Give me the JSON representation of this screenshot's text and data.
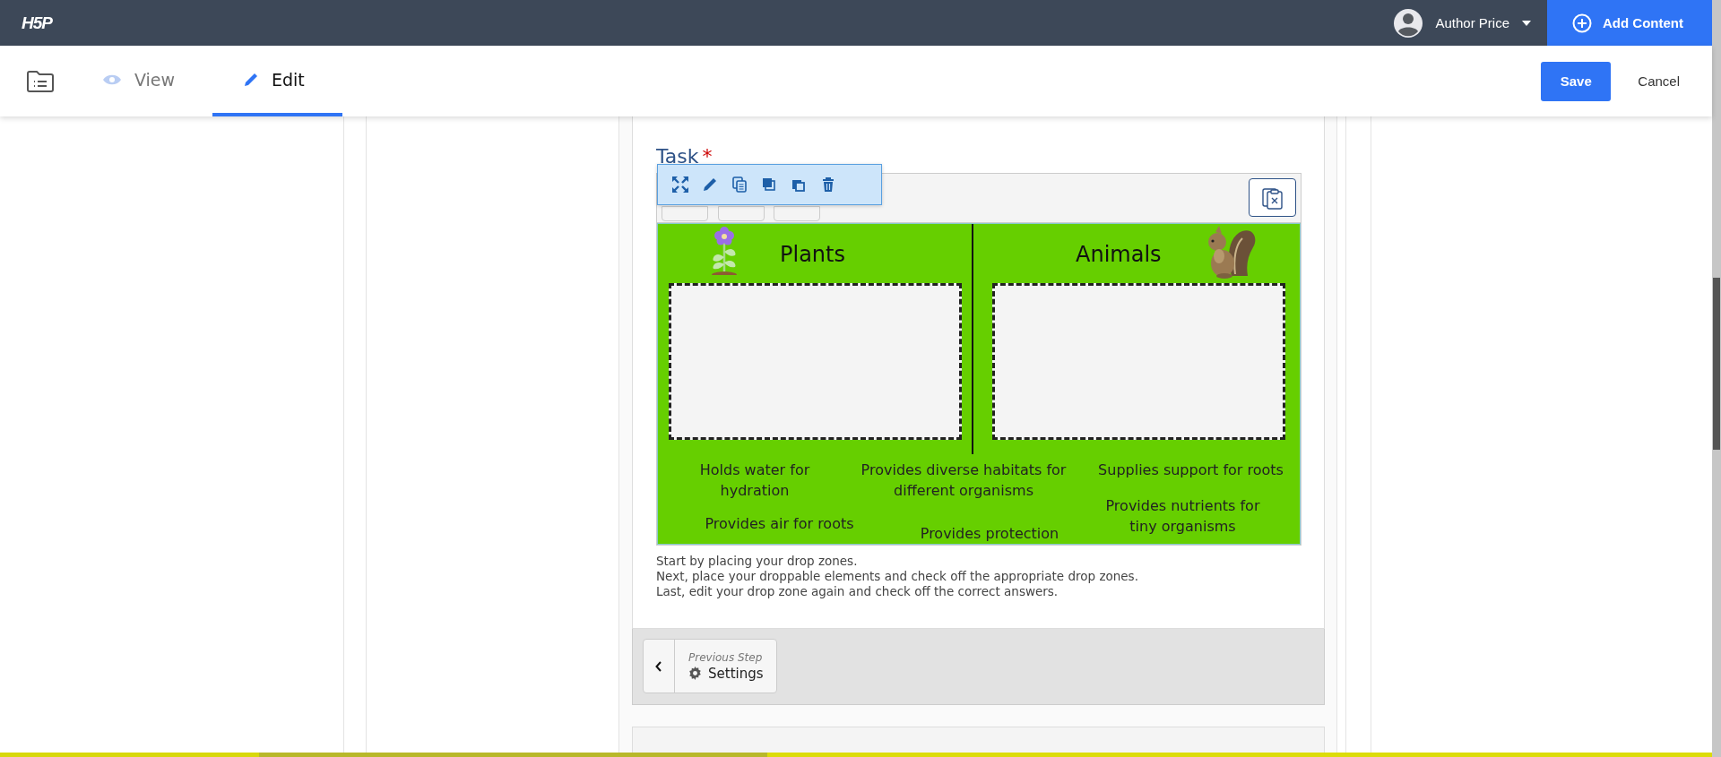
{
  "header": {
    "logo": "H5P",
    "user": "Author Price",
    "add_content": "Add Content"
  },
  "tabs": [
    {
      "label": "View",
      "selected": false
    },
    {
      "label": "Edit",
      "selected": true
    }
  ],
  "actions": {
    "save": "Save",
    "cancel": "Cancel"
  },
  "task": {
    "label": "Task",
    "required_mark": "*",
    "zones": [
      {
        "title": "Plants"
      },
      {
        "title": "Animals"
      }
    ],
    "items": [
      {
        "text": "Holds water for hydration"
      },
      {
        "text": "Provides diverse habitats for different organisms"
      },
      {
        "text": "Supplies support for roots"
      },
      {
        "text": "Provides air for roots"
      },
      {
        "text": "Provides protection"
      },
      {
        "text": "Provides nutrients for tiny organisms"
      }
    ],
    "instructions": [
      "Start by placing your drop zones.",
      "Next, place your droppable elements and check off the appropriate drop zones.",
      "Last, edit your drop zone again and check off the correct answers."
    ]
  },
  "footer": {
    "previous_label": "Previous Step",
    "previous_title": "Settings"
  }
}
